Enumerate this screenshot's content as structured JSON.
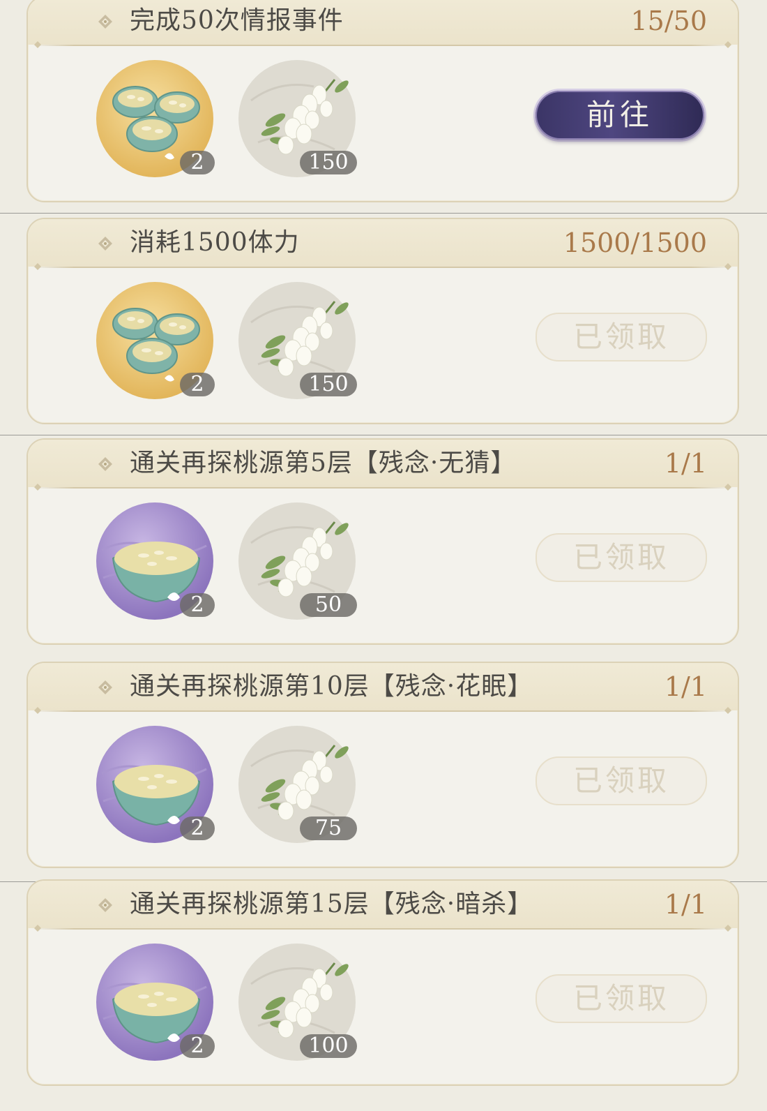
{
  "tasks": [
    {
      "title": "完成50次情报事件",
      "progress": "15/50",
      "reward1": {
        "icon": "tea-cups-gold",
        "count": "2"
      },
      "reward2": {
        "icon": "white-flower",
        "count": "150"
      },
      "button": "前往",
      "state": "goto"
    },
    {
      "title": "消耗1500体力",
      "progress": "1500/1500",
      "reward1": {
        "icon": "tea-cups-gold",
        "count": "2"
      },
      "reward2": {
        "icon": "white-flower",
        "count": "150"
      },
      "button": "已领取",
      "state": "claimed"
    },
    {
      "title": "通关再探桃源第5层【残念·无猜】",
      "progress": "1/1",
      "reward1": {
        "icon": "tea-bowl-purple",
        "count": "2"
      },
      "reward2": {
        "icon": "white-flower",
        "count": "50"
      },
      "button": "已领取",
      "state": "claimed"
    },
    {
      "title": "通关再探桃源第10层【残念·花眠】",
      "progress": "1/1",
      "reward1": {
        "icon": "tea-bowl-purple",
        "count": "2"
      },
      "reward2": {
        "icon": "white-flower",
        "count": "75"
      },
      "button": "已领取",
      "state": "claimed"
    },
    {
      "title": "通关再探桃源第15层【残念·暗杀】",
      "progress": "1/1",
      "reward1": {
        "icon": "tea-bowl-purple",
        "count": "2"
      },
      "reward2": {
        "icon": "white-flower",
        "count": "100"
      },
      "button": "已领取",
      "state": "claimed"
    }
  ],
  "colors": {
    "progress": "#a9794a",
    "goto": "#3b3566",
    "claimed": "#d9d1be",
    "gold_rarity": "#e9c36a",
    "purple_rarity": "#9a84c4"
  }
}
